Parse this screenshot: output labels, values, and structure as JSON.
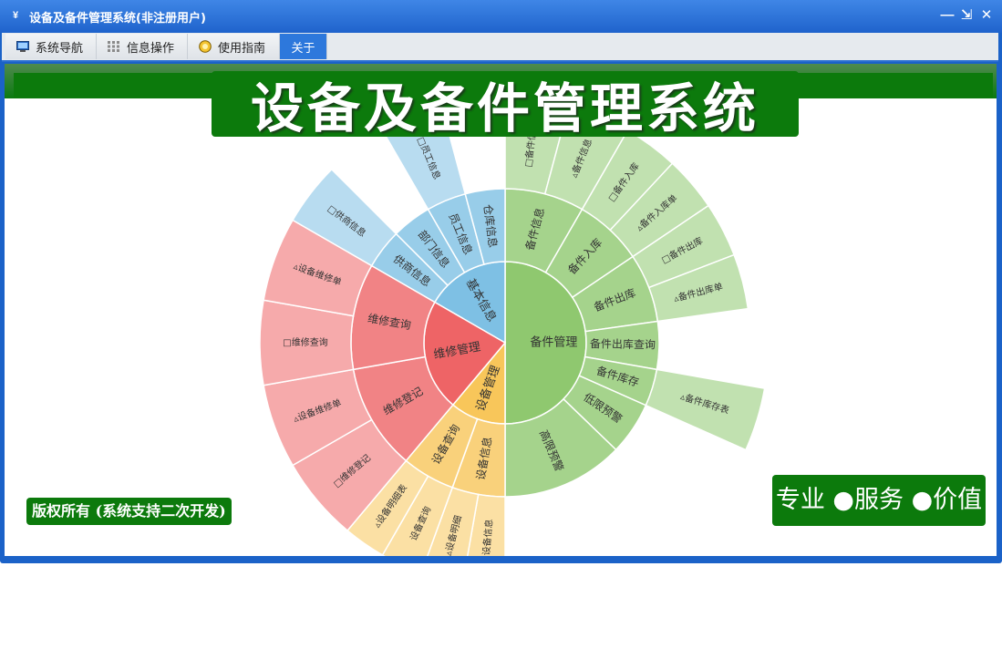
{
  "window": {
    "title": "设备及备件管理系统(非注册用户)",
    "app_icon": "app-logo-icon",
    "controls": {
      "minimize": "—",
      "restore": "⇲",
      "close": "✕"
    }
  },
  "tabs": [
    {
      "label": "系统导航",
      "icon": "monitor-icon"
    },
    {
      "label": "信息操作",
      "icon": "grid-icon"
    },
    {
      "label": "使用指南",
      "icon": "help-icon"
    },
    {
      "label": "关于",
      "icon": "",
      "active": true
    }
  ],
  "banner": {
    "title": "设备及备件管理系统"
  },
  "copyright": "版权所有 (系统支持二次开发)",
  "slogan": "专业 ●服务 ●价值",
  "colors": {
    "green": "#0c7a0c",
    "title_blue": "#1f63cc",
    "sector_base": "#7ec0e4",
    "sector_parts": "#8fc86f",
    "sector_equipment": "#f8c65a",
    "sector_repair": "#ee6466"
  },
  "chart_data": {
    "type": "sunburst",
    "root": [
      {
        "name": "备件管理",
        "children": [
          {
            "name": "备件信息",
            "children": [
              "□备件信息",
              "▵备件信息"
            ]
          },
          {
            "name": "备件入库",
            "children": [
              "□备件入库",
              "▵备件入库单"
            ]
          },
          {
            "name": "备件出库",
            "children": [
              "□备件出库",
              "▵备件出库单"
            ]
          },
          {
            "name": "备件出库查询",
            "children": []
          },
          {
            "name": "备件库存",
            "children": [
              "▵备件库存表"
            ]
          },
          {
            "name": "低限预警",
            "children": []
          },
          {
            "name": "高限预警",
            "children": []
          }
        ]
      },
      {
        "name": "设备管理",
        "children": [
          {
            "name": "设备信息",
            "children": [
              "□设备信息",
              "▵设备明细"
            ]
          },
          {
            "name": "设备查询",
            "children": [
              "设备查询",
              "▵设备明细表"
            ]
          }
        ]
      },
      {
        "name": "维修管理",
        "children": [
          {
            "name": "维修登记",
            "children": [
              "□维修登记",
              "▵设备维修单"
            ]
          },
          {
            "name": "维修查询",
            "children": [
              "□维修查询",
              "▵设备维修单"
            ]
          }
        ]
      },
      {
        "name": "基本信息",
        "children": [
          {
            "name": "供商信息",
            "children": [
              "□供商信息"
            ]
          },
          {
            "name": "部门信息",
            "children": []
          },
          {
            "name": "员工信息",
            "children": [
              "□员工信息"
            ]
          },
          {
            "name": "仓库信息",
            "children": []
          }
        ]
      }
    ]
  }
}
